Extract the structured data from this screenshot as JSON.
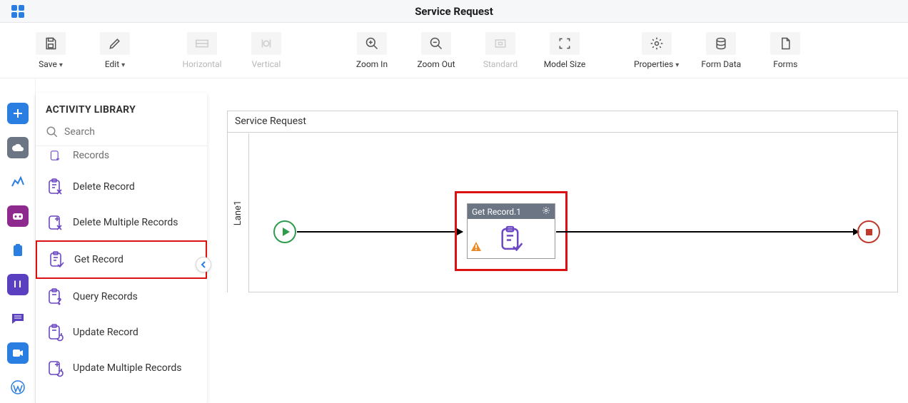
{
  "titlebar": {
    "title": "Service Request"
  },
  "toolbar": {
    "save": "Save",
    "edit": "Edit",
    "horizontal": "Horizontal",
    "vertical": "Vertical",
    "zoom_in": "Zoom In",
    "zoom_out": "Zoom Out",
    "standard": "Standard",
    "model_size": "Model Size",
    "properties": "Properties",
    "form_data": "Form Data",
    "forms": "Forms"
  },
  "library": {
    "heading": "ACTIVITY LIBRARY",
    "search_placeholder": "Search",
    "items": {
      "partial_top": "Records",
      "delete_record": "Delete Record",
      "delete_multiple": "Delete Multiple Records",
      "get_record": "Get Record",
      "query_records": "Query Records",
      "update_record": "Update Record",
      "update_multiple": "Update Multiple Records"
    }
  },
  "canvas": {
    "title": "Service Request",
    "lane": "Lane1",
    "activity_label": "Get Record.1"
  }
}
